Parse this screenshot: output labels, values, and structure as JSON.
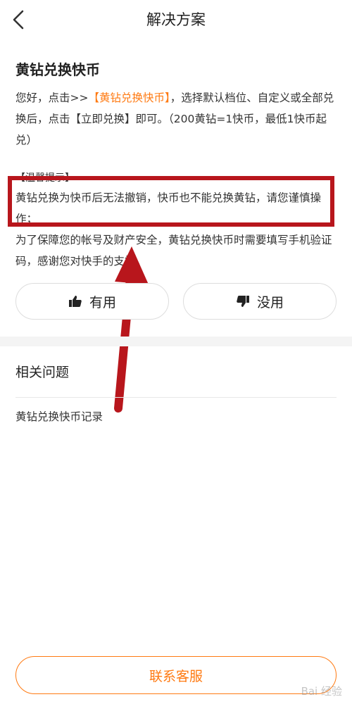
{
  "header": {
    "title": "解决方案",
    "back_icon": "chevron-left-icon"
  },
  "article": {
    "title": "黄钻兑换快币",
    "intro_before": "您好，点击>>",
    "intro_link": "【黄钻兑换快币】",
    "intro_after": "，选择默认档位、自定义或全部兑换后，点击【立即兑换】即可。（200黄钻=1快币，最低1快币起兑）",
    "warn_title": "【温馨提示】",
    "warn_text": "黄钻兑换为快币后无法撤销，快币也不能兑换黄钻，请您谨慎操作；",
    "security_text": "为了保障您的帐号及财产安全，黄钻兑换快币时需要填写手机验证码，感谢您对快手的支持。"
  },
  "feedback": {
    "useful_label": "有用",
    "useless_label": "没用"
  },
  "related": {
    "title": "相关问题",
    "items": [
      "黄钻兑换快币记录"
    ]
  },
  "footer": {
    "contact_label": "联系客服"
  },
  "watermark": "Bai 经验",
  "colors": {
    "accent": "#ff7a12",
    "annotation_red": "#b8161c"
  }
}
